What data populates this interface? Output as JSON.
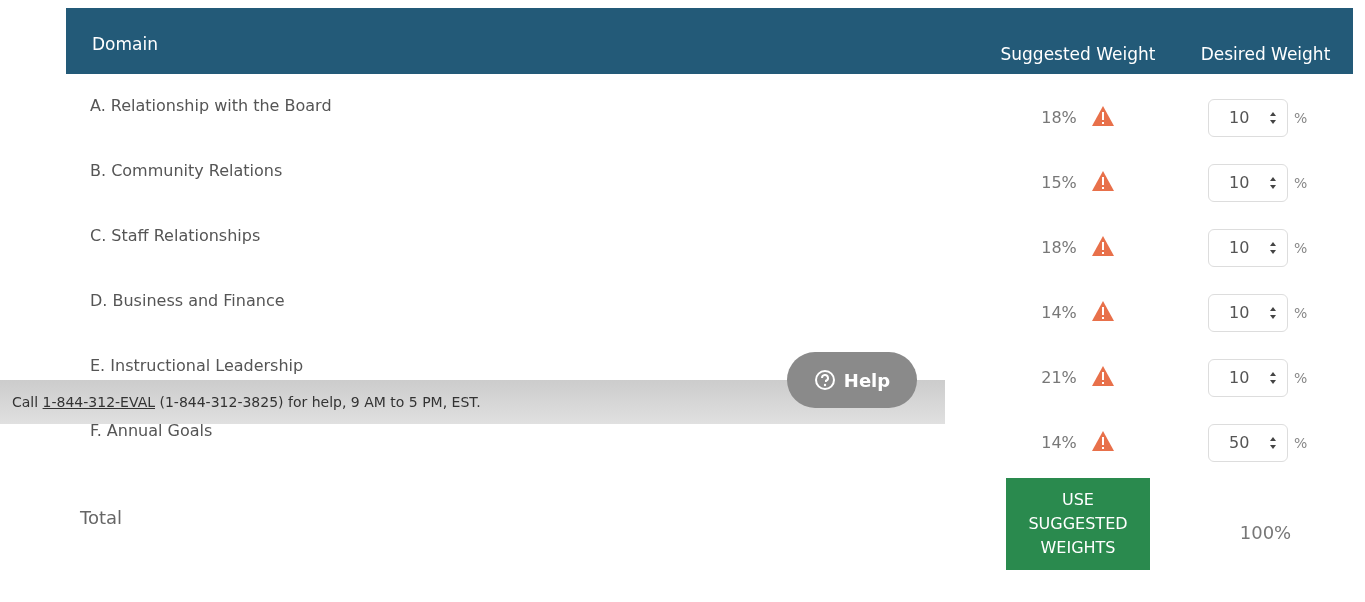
{
  "table": {
    "columns": [
      {
        "label": "Domain"
      },
      {
        "label": "Suggested Weight"
      },
      {
        "label": "Desired Weight"
      }
    ],
    "rows": [
      {
        "domain": "A. Relationship with the Board",
        "suggested": "18%",
        "warning": true,
        "desired": "10",
        "unit": "%"
      },
      {
        "domain": "B. Community Relations",
        "suggested": "15%",
        "warning": true,
        "desired": "10",
        "unit": "%"
      },
      {
        "domain": "C. Staff Relationships",
        "suggested": "18%",
        "warning": true,
        "desired": "10",
        "unit": "%"
      },
      {
        "domain": "D. Business and Finance",
        "suggested": "14%",
        "warning": true,
        "desired": "10",
        "unit": "%"
      },
      {
        "domain": "E. Instructional Leadership",
        "suggested": "21%",
        "warning": true,
        "desired": "10",
        "unit": "%"
      },
      {
        "domain": "F. Annual Goals",
        "suggested": "14%",
        "warning": true,
        "desired": "50",
        "unit": "%"
      }
    ],
    "total": {
      "label": "Total",
      "button": "USE SUGGESTED WEIGHTS",
      "value": "100%"
    }
  },
  "help_bar": {
    "prefix": "Call ",
    "link": "1-844-312-EVAL",
    "suffix": " (1-844-312-3825) for help, 9 AM to 5 PM, EST.",
    "button": "Help"
  }
}
